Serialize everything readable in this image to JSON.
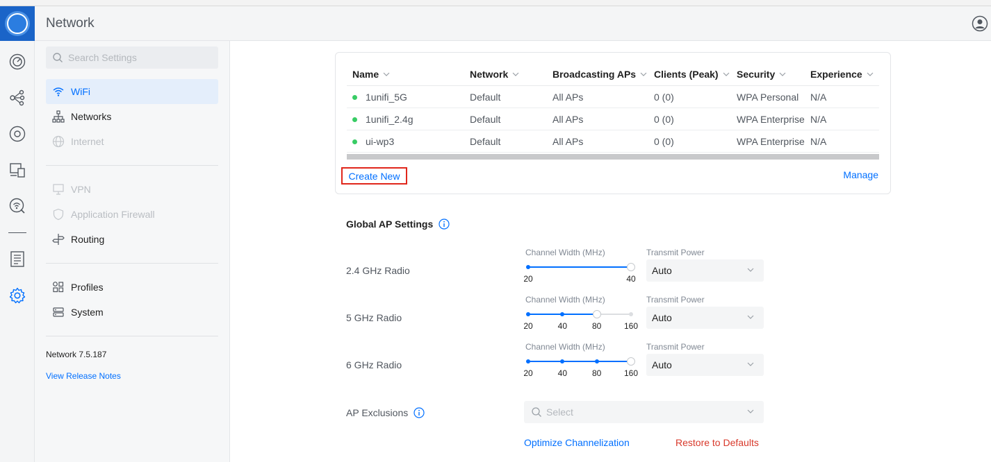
{
  "app": {
    "title": "Network"
  },
  "search": {
    "placeholder": "Search Settings",
    "value": ""
  },
  "sidebar": {
    "items": [
      {
        "label": "WiFi",
        "state": "active"
      },
      {
        "label": "Networks",
        "state": "normal"
      },
      {
        "label": "Internet",
        "state": "disabled"
      },
      {
        "label": "VPN",
        "state": "disabled"
      },
      {
        "label": "Application Firewall",
        "state": "disabled"
      },
      {
        "label": "Routing",
        "state": "normal"
      },
      {
        "label": "Profiles",
        "state": "normal"
      },
      {
        "label": "System",
        "state": "normal"
      }
    ],
    "version": "Network 7.5.187",
    "release_notes": "View Release Notes"
  },
  "wifi_table": {
    "columns": [
      "Name",
      "Network",
      "Broadcasting APs",
      "Clients (Peak)",
      "Security",
      "Experience"
    ],
    "rows": [
      {
        "name": "1unifi_5G",
        "network": "Default",
        "aps": "All APs",
        "clients": "0 (0)",
        "security": "WPA Personal",
        "experience": "N/A"
      },
      {
        "name": "1unifi_2.4g",
        "network": "Default",
        "aps": "All APs",
        "clients": "0 (0)",
        "security": "WPA Enterprise",
        "experience": "N/A"
      },
      {
        "name": "ui-wp3",
        "network": "Default",
        "aps": "All APs",
        "clients": "0 (0)",
        "security": "WPA Enterprise",
        "experience": "N/A"
      }
    ],
    "create_new": "Create New",
    "manage": "Manage"
  },
  "global_ap": {
    "title": "Global AP Settings",
    "channel_width_label": "Channel Width (MHz)",
    "transmit_power_label": "Transmit Power",
    "radios": [
      {
        "label": "2.4 GHz Radio",
        "options": [
          "20",
          "40"
        ],
        "selected": "40",
        "transmit_power": "Auto"
      },
      {
        "label": "5 GHz Radio",
        "options": [
          "20",
          "40",
          "80",
          "160"
        ],
        "selected": "80",
        "transmit_power": "Auto"
      },
      {
        "label": "6 GHz Radio",
        "options": [
          "20",
          "40",
          "80",
          "160"
        ],
        "selected": "160",
        "transmit_power": "Auto"
      }
    ],
    "ap_exclusions_label": "AP Exclusions",
    "ap_exclusions_placeholder": "Select",
    "optimize": "Optimize Channelization",
    "restore": "Restore to Defaults"
  },
  "colors": {
    "accent": "#006fff",
    "active_bg": "#e4eefb",
    "status_online": "#38cc65",
    "danger": "#d8382a",
    "highlight_box": "#e0261b"
  }
}
